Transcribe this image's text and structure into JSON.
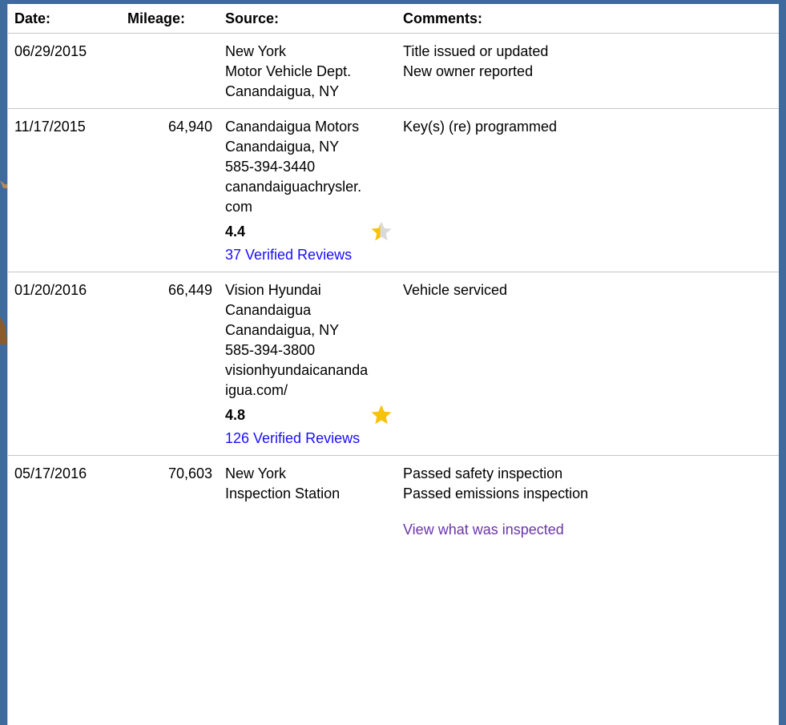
{
  "colors": {
    "frame": "#3f6a9d",
    "link": "#1a0dff",
    "visited_link": "#6a35a8",
    "star_fill": "#f7c20a",
    "star_empty": "#d9d9d9",
    "divider": "#c6c6c6"
  },
  "headers": {
    "date": "Date:",
    "mileage": "Mileage:",
    "source": "Source:",
    "comments": "Comments:"
  },
  "rows": [
    {
      "date": "06/29/2015",
      "mileage": "",
      "source": [
        "New York",
        "Motor Vehicle Dept.",
        "Canandaigua, NY"
      ],
      "comments": [
        "Title issued or updated",
        "New owner reported"
      ]
    },
    {
      "date": "11/17/2015",
      "mileage": "64,940",
      "source": [
        "Canandaigua Motors",
        "Canandaigua, NY",
        "585-394-3440",
        "canandaiguachrysler.",
        "com"
      ],
      "rating": {
        "score": "4.4",
        "stars_fill": 0.44,
        "reviews": "37 Verified Reviews",
        "icon": "half-star-icon"
      },
      "comments": [
        "Key(s) (re) programmed"
      ]
    },
    {
      "date": "01/20/2016",
      "mileage": "66,449",
      "source": [
        "Vision Hyundai",
        "Canandaigua",
        "Canandaigua, NY",
        "585-394-3800",
        "visionhyundaicananda",
        "igua.com/"
      ],
      "rating": {
        "score": "4.8",
        "stars_fill": 0.96,
        "reviews": "126 Verified Reviews",
        "icon": "star-icon"
      },
      "comments": [
        "Vehicle serviced"
      ]
    },
    {
      "date": "05/17/2016",
      "mileage": "70,603",
      "source": [
        "New York",
        "Inspection Station"
      ],
      "comments": [
        "Passed safety inspection",
        "Passed emissions inspection"
      ],
      "comment_link": "View what was inspected"
    }
  ]
}
